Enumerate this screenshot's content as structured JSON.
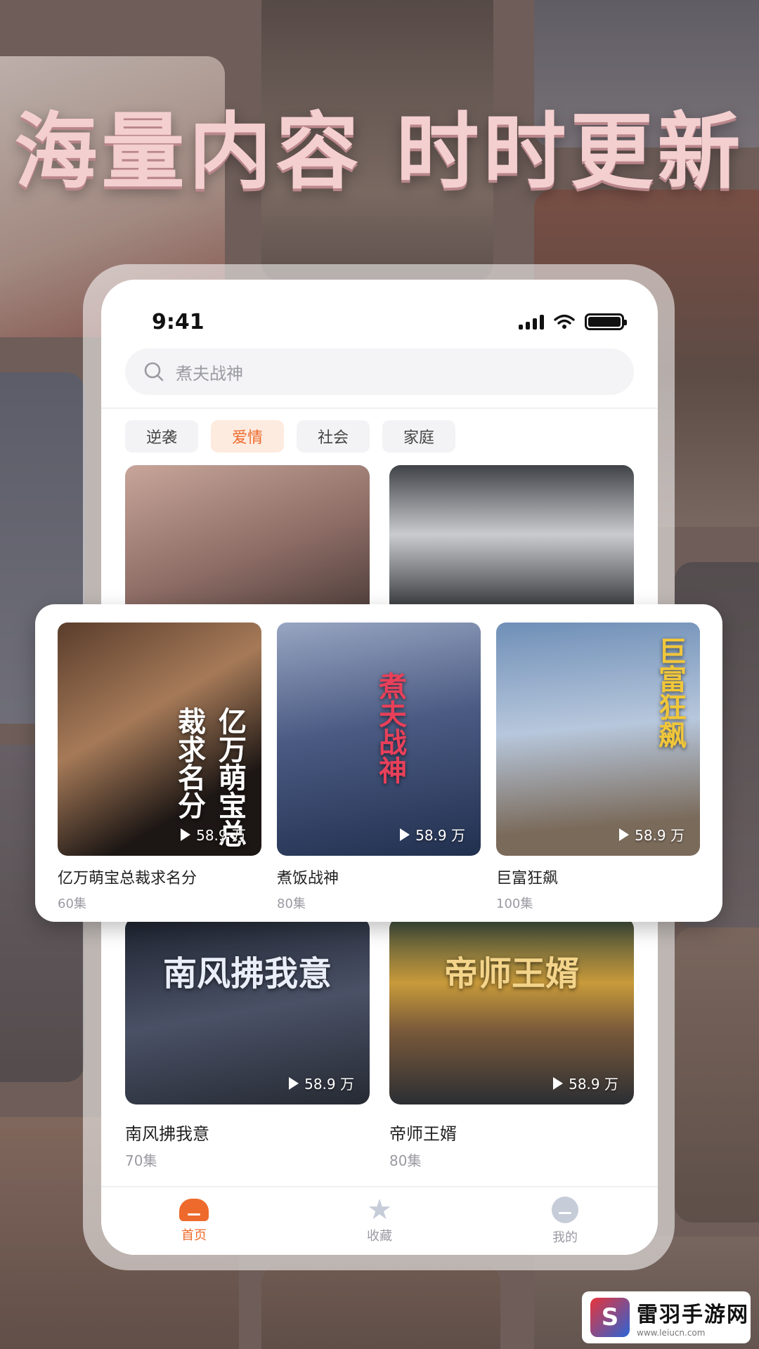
{
  "hero": {
    "title": "海量内容 时时更新"
  },
  "status_bar": {
    "time": "9:41"
  },
  "search": {
    "placeholder": "煮夫战神"
  },
  "tabs": [
    {
      "label": "逆袭",
      "active": false
    },
    {
      "label": "爱情",
      "active": true
    },
    {
      "label": "社会",
      "active": false
    },
    {
      "label": "家庭",
      "active": false
    }
  ],
  "featured": [
    {
      "title": "亿万萌宝总裁求名分",
      "episodes": "60集",
      "play_count": "58.9 万",
      "poster_text": "亿万萌宝总裁求名分"
    },
    {
      "title": "煮饭战神",
      "episodes": "80集",
      "play_count": "58.9 万",
      "poster_text": "煮夫战神"
    },
    {
      "title": "巨富狂飙",
      "episodes": "100集",
      "play_count": "58.9 万",
      "poster_text": "巨富狂飙"
    }
  ],
  "grid": [
    {
      "title": "南风拂我意",
      "episodes": "70集",
      "play_count": "58.9 万",
      "poster_text": "南风拂我意"
    },
    {
      "title": "帝师王婿",
      "episodes": "80集",
      "play_count": "58.9 万",
      "poster_text": "帝师王婿"
    }
  ],
  "bottom_nav": [
    {
      "label": "首页",
      "icon": "home-icon",
      "active": true
    },
    {
      "label": "收藏",
      "icon": "star-icon",
      "active": false
    },
    {
      "label": "我的",
      "icon": "user-icon",
      "active": false
    }
  ],
  "watermark": {
    "name": "雷羽手游网",
    "url": "www.leiucn.com"
  },
  "colors": {
    "accent": "#ee6a2c",
    "hero_text": "#f4cfd0"
  }
}
